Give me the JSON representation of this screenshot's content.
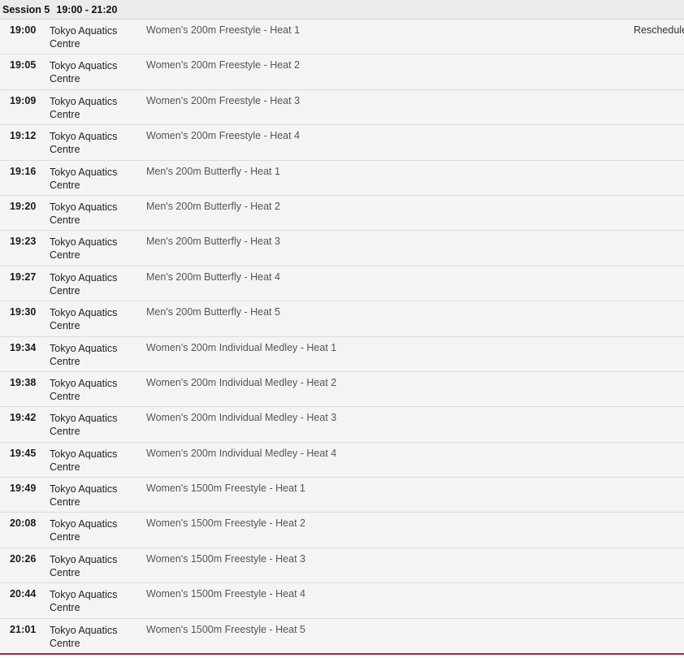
{
  "session": {
    "label": "Session 5",
    "time_range": "19:00 - 21:20"
  },
  "rows": [
    {
      "time": "19:00",
      "venue": "Tokyo Aquatics Centre",
      "event": "Women's 200m Freestyle - Heat 1",
      "status": "Reschedule"
    },
    {
      "time": "19:05",
      "venue": "Tokyo Aquatics Centre",
      "event": "Women's 200m Freestyle - Heat 2",
      "status": ""
    },
    {
      "time": "19:09",
      "venue": "Tokyo Aquatics Centre",
      "event": "Women's 200m Freestyle - Heat 3",
      "status": ""
    },
    {
      "time": "19:12",
      "venue": "Tokyo Aquatics Centre",
      "event": "Women's 200m Freestyle - Heat 4",
      "status": ""
    },
    {
      "time": "19:16",
      "venue": "Tokyo Aquatics Centre",
      "event": "Men's 200m Butterfly - Heat 1",
      "status": ""
    },
    {
      "time": "19:20",
      "venue": "Tokyo Aquatics Centre",
      "event": "Men's 200m Butterfly - Heat 2",
      "status": ""
    },
    {
      "time": "19:23",
      "venue": "Tokyo Aquatics Centre",
      "event": "Men's 200m Butterfly - Heat 3",
      "status": ""
    },
    {
      "time": "19:27",
      "venue": "Tokyo Aquatics Centre",
      "event": "Men's 200m Butterfly - Heat 4",
      "status": ""
    },
    {
      "time": "19:30",
      "venue": "Tokyo Aquatics Centre",
      "event": "Men's 200m Butterfly - Heat 5",
      "status": ""
    },
    {
      "time": "19:34",
      "venue": "Tokyo Aquatics Centre",
      "event": "Women's 200m Individual Medley - Heat 1",
      "status": ""
    },
    {
      "time": "19:38",
      "venue": "Tokyo Aquatics Centre",
      "event": "Women's 200m Individual Medley - Heat 2",
      "status": ""
    },
    {
      "time": "19:42",
      "venue": "Tokyo Aquatics Centre",
      "event": "Women's 200m Individual Medley - Heat 3",
      "status": ""
    },
    {
      "time": "19:45",
      "venue": "Tokyo Aquatics Centre",
      "event": "Women's 200m Individual Medley - Heat 4",
      "status": ""
    },
    {
      "time": "19:49",
      "venue": "Tokyo Aquatics Centre",
      "event": "Women's 1500m Freestyle - Heat 1",
      "status": ""
    },
    {
      "time": "20:08",
      "venue": "Tokyo Aquatics Centre",
      "event": "Women's 1500m Freestyle - Heat 2",
      "status": ""
    },
    {
      "time": "20:26",
      "venue": "Tokyo Aquatics Centre",
      "event": "Women's 1500m Freestyle - Heat 3",
      "status": ""
    },
    {
      "time": "20:44",
      "venue": "Tokyo Aquatics Centre",
      "event": "Women's 1500m Freestyle - Heat 4",
      "status": ""
    },
    {
      "time": "21:01",
      "venue": "Tokyo Aquatics Centre",
      "event": "Women's 1500m Freestyle - Heat 5",
      "status": ""
    }
  ],
  "colors": {
    "row_background": "#f4f4f4",
    "header_background": "#ebebeb",
    "bottom_accent": "#9a2a45"
  }
}
